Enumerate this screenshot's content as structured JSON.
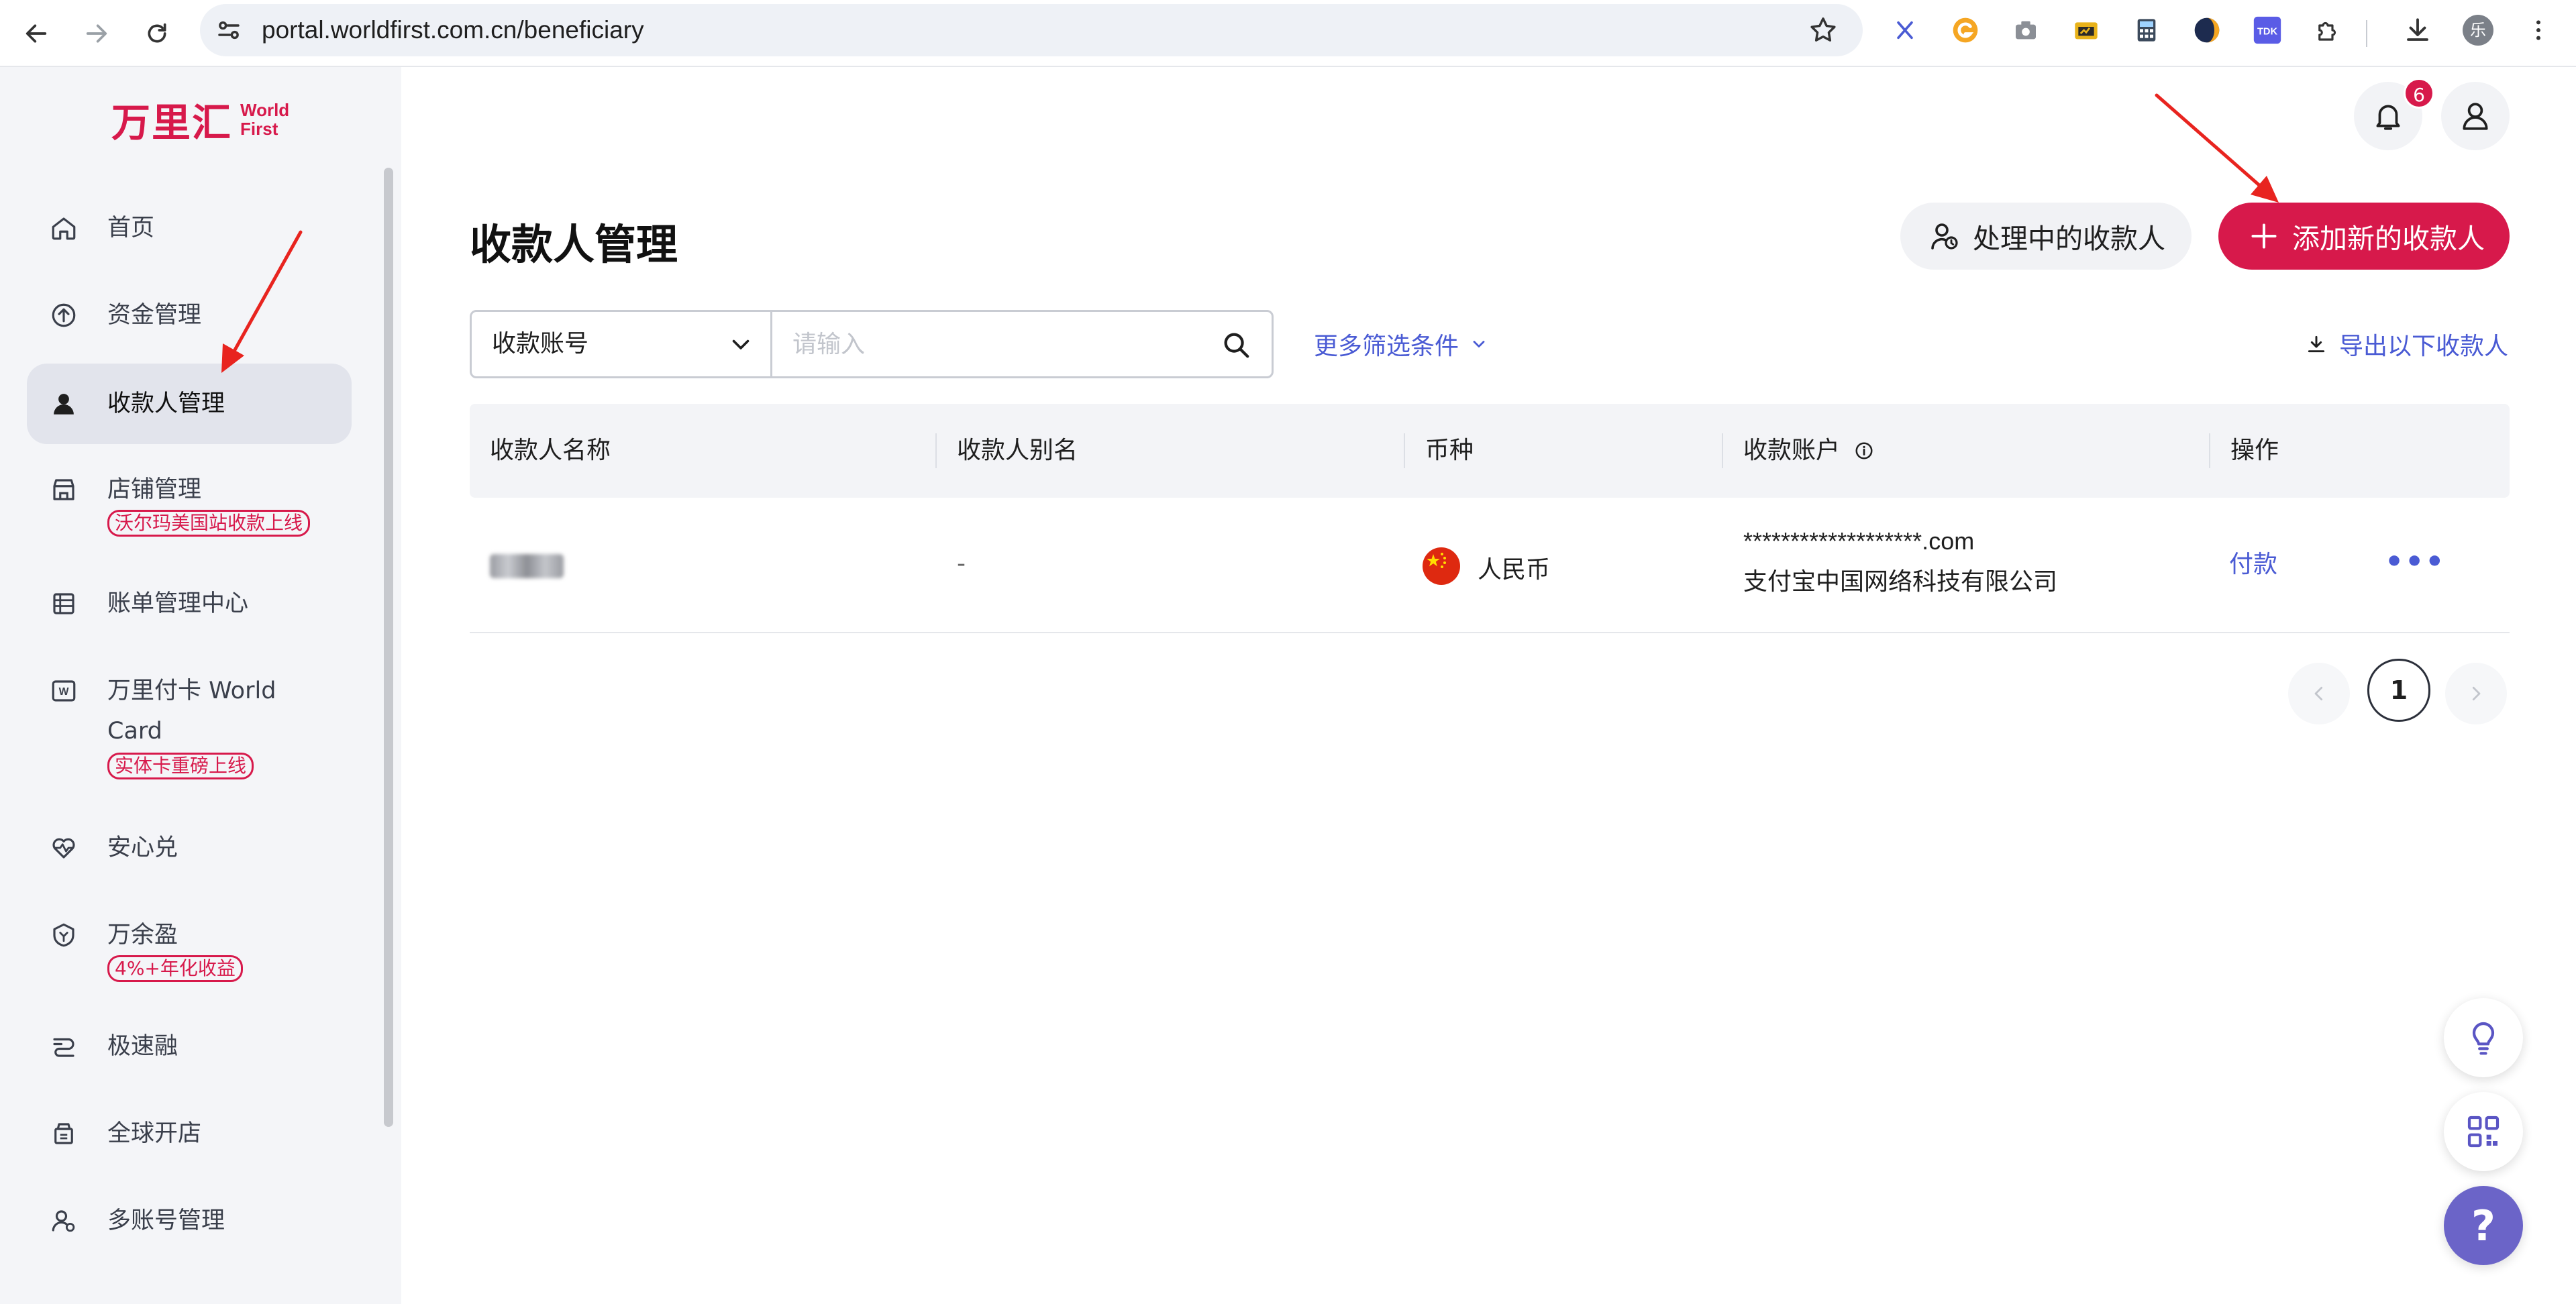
{
  "browser": {
    "url": "portal.worldfirst.com.cn/beneficiary",
    "profile_initial": "乐"
  },
  "brand": {
    "logo_cn": "万里汇",
    "logo_en_line1": "World",
    "logo_en_line2": "First",
    "accent": "#d7194b",
    "link": "#4a5bd4"
  },
  "sidebar": {
    "items": [
      {
        "label": "首页",
        "icon": "home-icon"
      },
      {
        "label": "资金管理",
        "icon": "funds-icon"
      },
      {
        "label": "收款人管理",
        "icon": "person-icon",
        "active": true
      },
      {
        "label": "店铺管理",
        "icon": "store-icon",
        "badge": "沃尔玛美国站收款上线"
      },
      {
        "label": "账单管理中心",
        "icon": "bill-icon"
      },
      {
        "label_line1": "万里付卡 World",
        "label_line2": "Card",
        "icon": "card-icon",
        "badge": "实体卡重磅上线"
      },
      {
        "label": "安心兑",
        "icon": "exchange-icon"
      },
      {
        "label": "万余盈",
        "icon": "savings-icon",
        "badge": "4%+年化收益"
      },
      {
        "label": "极速融",
        "icon": "finance-icon"
      },
      {
        "label": "全球开店",
        "icon": "global-store-icon"
      },
      {
        "label": "多账号管理",
        "icon": "multi-account-icon"
      }
    ]
  },
  "header": {
    "notification_count": "6"
  },
  "main": {
    "title": "收款人管理",
    "pending_button": "处理中的收款人",
    "add_button": "添加新的收款人",
    "filter": {
      "select_value": "收款账号",
      "input_placeholder": "请输入",
      "more_filters": "更多筛选条件"
    },
    "export_label": "导出以下收款人",
    "table": {
      "columns": [
        "收款人名称",
        "收款人别名",
        "币种",
        "收款账户",
        "操作"
      ],
      "rows": [
        {
          "name": "",
          "alias": "-",
          "currency": "人民币",
          "account_line1": "*******************.com",
          "account_line2": "支付宝中国网络科技有限公司",
          "action": "付款"
        }
      ]
    },
    "pagination": {
      "current": "1"
    }
  }
}
